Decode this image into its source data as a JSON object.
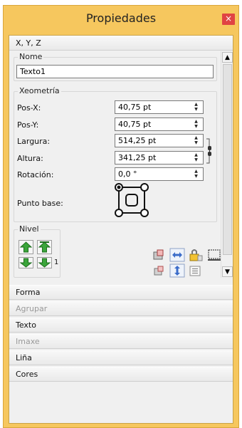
{
  "window": {
    "title": "Propiedades",
    "close_symbol": "×"
  },
  "sections": {
    "xyz": "X, Y, Z",
    "forma": "Forma",
    "agrupar": "Agrupar",
    "texto": "Texto",
    "imaxe": "Imaxe",
    "lina": "Liña",
    "cores": "Cores"
  },
  "nome": {
    "legend": "Nome",
    "value": "Texto1"
  },
  "xeometria": {
    "legend": "Xeometría",
    "pos_x": {
      "label": "Pos-X:",
      "value": "40,75 pt"
    },
    "pos_y": {
      "label": "Pos-Y:",
      "value": "40,75 pt"
    },
    "largura": {
      "label": "Largura:",
      "value": "514,25 pt"
    },
    "altura": {
      "label": "Altura:",
      "value": "341,25 pt"
    },
    "rotacion": {
      "label": "Rotación:",
      "value": "0,0 °"
    },
    "punto_base": {
      "label": "Punto base:"
    }
  },
  "nivel": {
    "legend": "Nivel",
    "number": "1"
  },
  "colors": {
    "title_bar": "#f6c75e",
    "close_button": "#e04343",
    "panel": "#f0f0f0",
    "level_arrow": "#3aa53a"
  },
  "icons": {
    "close": "close-icon",
    "scroll_up": "scroll-up-arrow-icon",
    "scroll_down": "scroll-down-arrow-icon",
    "link": "chain-link-icon",
    "base_point": "base-point-selector-icon",
    "level_up_top": "raise-to-top-icon",
    "level_up": "raise-one-level-icon",
    "level_down_bottom": "lower-to-bottom-icon",
    "level_down": "lower-one-level-icon"
  }
}
